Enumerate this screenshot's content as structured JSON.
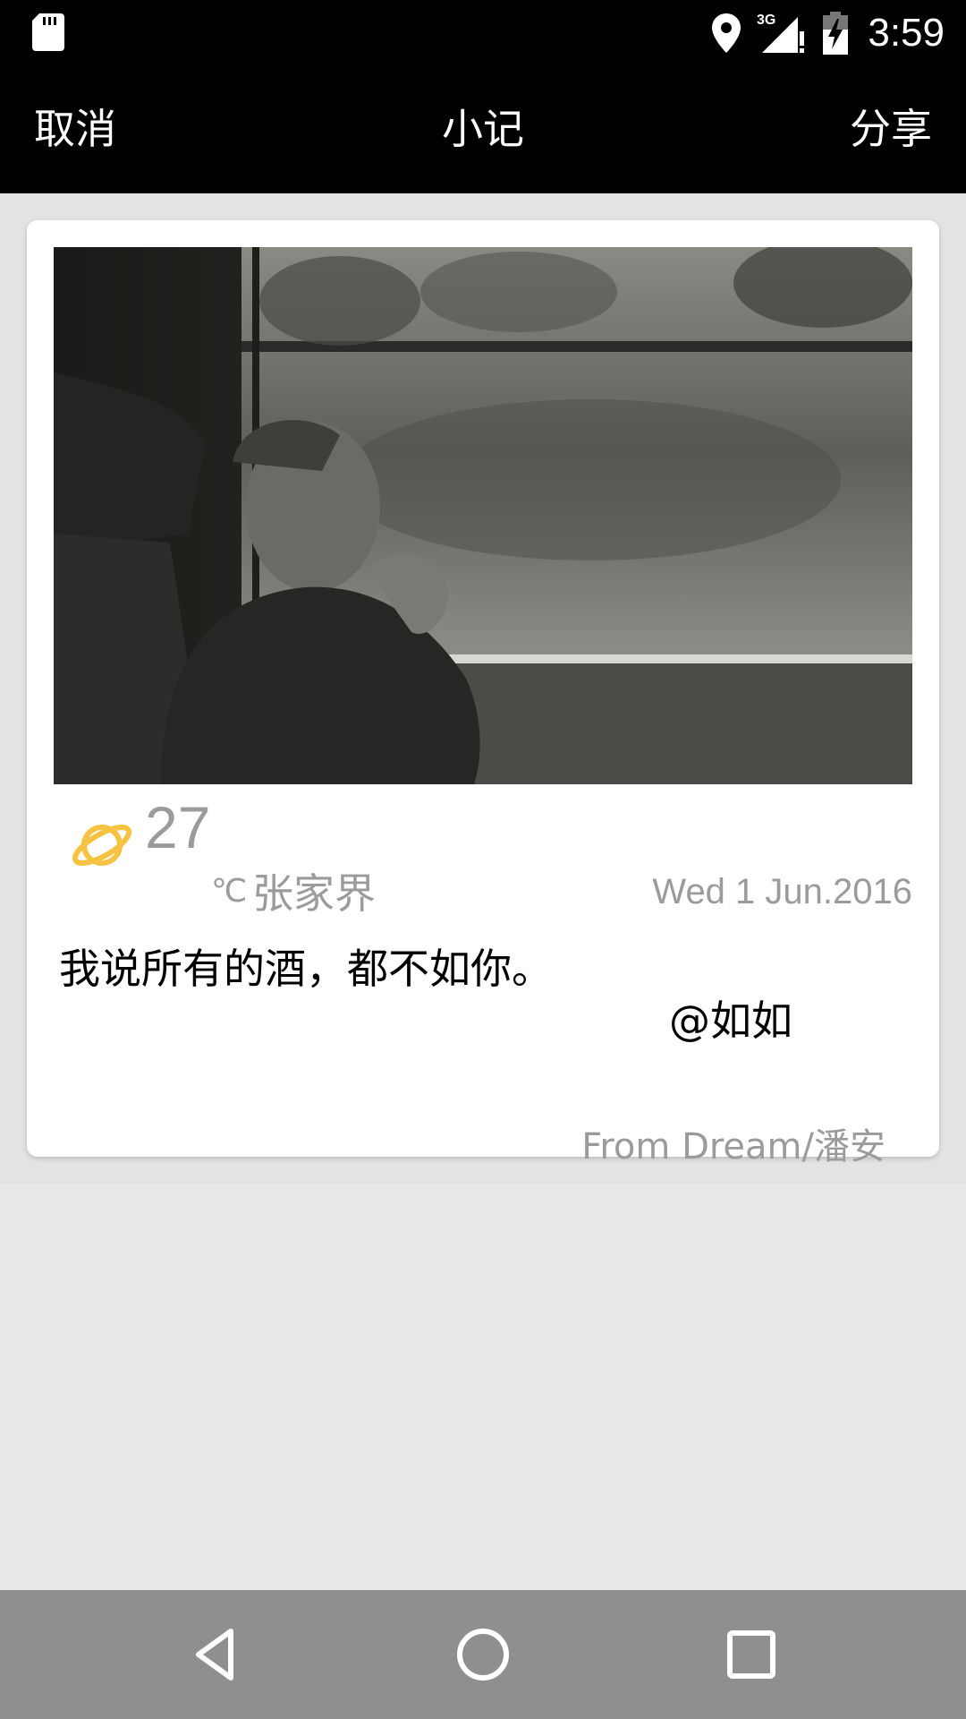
{
  "status_bar": {
    "time": "3:59",
    "network": "3G",
    "icons": [
      "sd-card-icon",
      "location-icon",
      "signal-icon",
      "battery-icon"
    ]
  },
  "toolbar": {
    "cancel_label": "取消",
    "title": "小记",
    "share_label": "分享"
  },
  "card": {
    "photo_description_icon": "photo-image",
    "weather": {
      "icon": "planet-weather-icon",
      "icon_color": "#f5c242",
      "temperature": "27",
      "unit": "℃",
      "city": "张家界"
    },
    "date": "Wed 1 Jun.2016",
    "message": "我说所有的酒，都不如你。",
    "mention": "@如如",
    "source": "From Dream/潘安"
  },
  "nav_bar": {
    "icons": [
      "back-icon",
      "home-icon",
      "recents-icon"
    ]
  }
}
